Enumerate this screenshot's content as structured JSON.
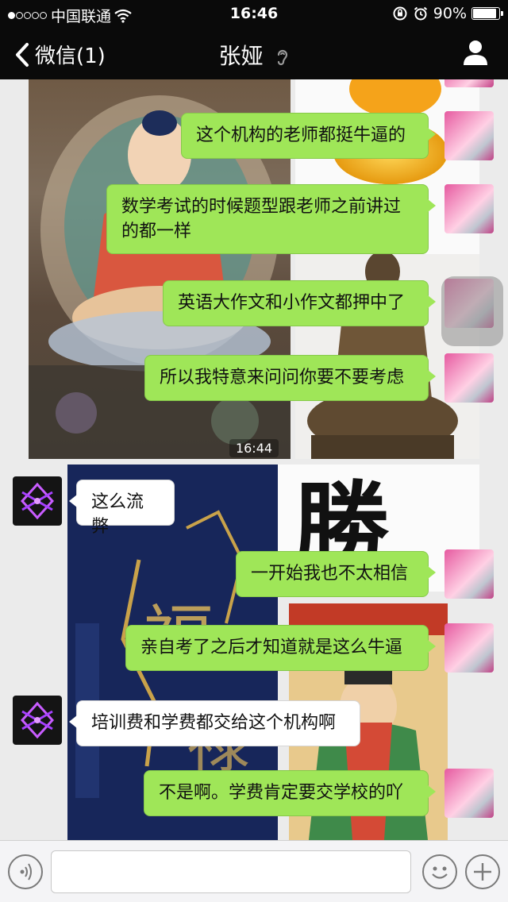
{
  "status_bar": {
    "carrier": "中国联通",
    "time": "16:46",
    "battery": "90%",
    "battery_level": 0.9
  },
  "nav": {
    "back_label": "微信(1)",
    "title": "张娅",
    "back_icon": "chevron-left-icon",
    "profile_icon": "person-icon",
    "earpiece_icon": "ear-icon"
  },
  "chat": {
    "timestamp": "16:44",
    "messages": [
      {
        "from": "me",
        "text": "这个机构的老师都挺牛逼的"
      },
      {
        "from": "me",
        "text": "数学考试的时候题型跟老师之前讲过的都一样"
      },
      {
        "from": "me",
        "text": "英语大作文和小作文都押中了"
      },
      {
        "from": "me",
        "text": "所以我特意来问问你要不要考虑"
      },
      {
        "from": "them",
        "text": "这么流弊"
      },
      {
        "from": "me",
        "text": "一开始我也不太相信"
      },
      {
        "from": "me",
        "text": "亲自考了之后才知道就是这么牛逼"
      },
      {
        "from": "them",
        "text": "培训费和学费都交给这个机构啊"
      },
      {
        "from": "me",
        "text": "不是啊。学费肯定要交学校的吖"
      }
    ]
  },
  "input_bar": {
    "voice_icon": "voice-icon",
    "emoji_icon": "smiley-icon",
    "plus_icon": "plus-icon",
    "placeholder": ""
  },
  "colors": {
    "me_bubble": "#9fe658",
    "them_bubble": "#ffffff",
    "nav_bg": "#0a0a0a"
  }
}
